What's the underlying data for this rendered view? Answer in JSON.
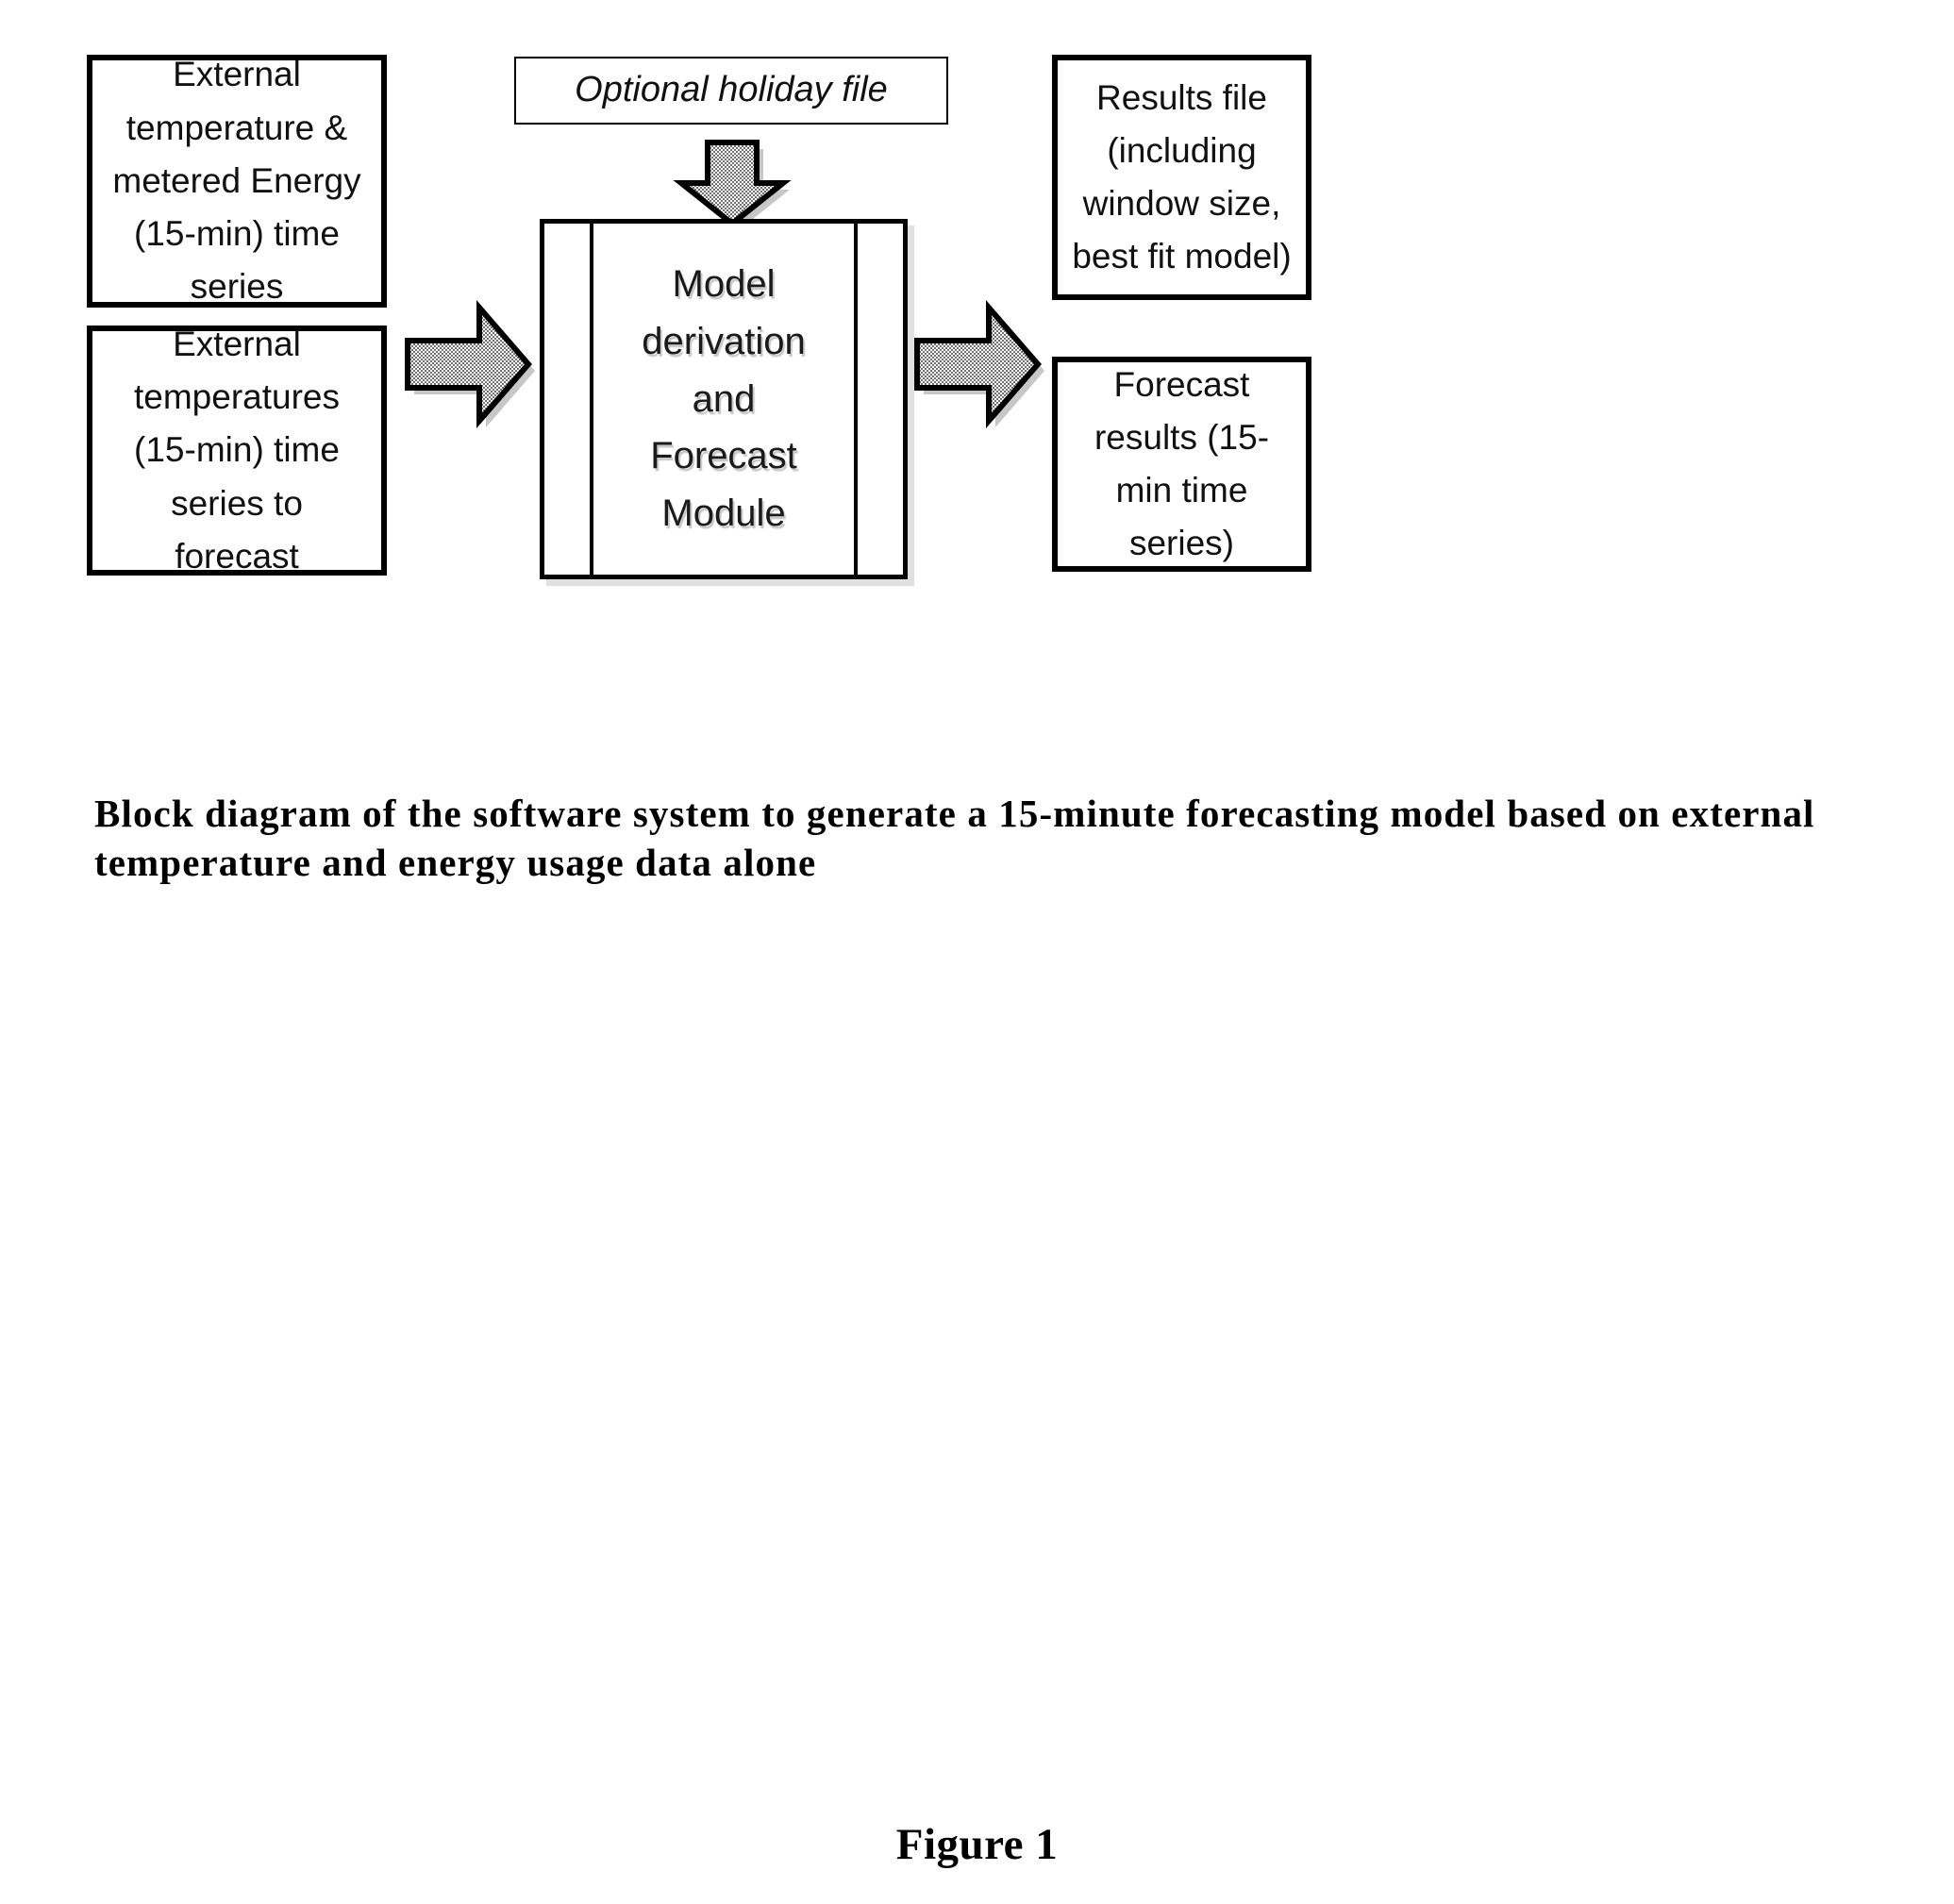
{
  "figure": {
    "number_label": "Figure 1",
    "caption": "Block diagram of the software system to generate a 15-minute forecasting model based on external temperature and energy usage data alone"
  },
  "diagram": {
    "type": "block-diagram",
    "inputs": [
      {
        "id": "input-metered-energy",
        "label": "External temperature & metered Energy (15-min) time series",
        "lines": [
          "External",
          "temperature &",
          "metered Energy",
          "(15-min) time",
          "series"
        ],
        "border": "thick"
      },
      {
        "id": "input-forecast-temperatures",
        "label": "External temperatures (15-min) time series to forecast",
        "lines": [
          "External",
          "temperatures (15-",
          "min) time series",
          "to forecast"
        ],
        "border": "thick"
      }
    ],
    "optional_input": {
      "id": "optional-holiday-file",
      "label": "Optional holiday file",
      "style": "italic",
      "border": "thin"
    },
    "process": {
      "id": "model-derivation-forecast-module",
      "label": "Model derivation and Forecast Module",
      "lines": [
        "Model",
        "derivation and",
        "Forecast",
        "Module"
      ],
      "shape": "predefined-process"
    },
    "outputs": [
      {
        "id": "output-results-file",
        "label": "Results file (including window size, best fit model)",
        "lines": [
          "Results file",
          "(including",
          "window size,",
          "best fit model)"
        ],
        "border": "thick"
      },
      {
        "id": "output-forecast-results",
        "label": "Forecast results (15-min time series)",
        "lines": [
          "Forecast results",
          "(15-min time",
          "series)"
        ],
        "border": "thick"
      }
    ],
    "connectors": [
      {
        "id": "arrow-inputs-to-module",
        "direction": "right",
        "from": "inputs",
        "to": "model-derivation-forecast-module"
      },
      {
        "id": "arrow-holiday-to-module",
        "direction": "down",
        "from": "optional-holiday-file",
        "to": "model-derivation-forecast-module"
      },
      {
        "id": "arrow-module-to-outputs",
        "direction": "right",
        "from": "model-derivation-forecast-module",
        "to": "outputs"
      }
    ]
  },
  "colors": {
    "page_background": "#ffffff",
    "stroke": "#000000",
    "arrow_fill": "#c9c9c9",
    "text": "#111111"
  }
}
